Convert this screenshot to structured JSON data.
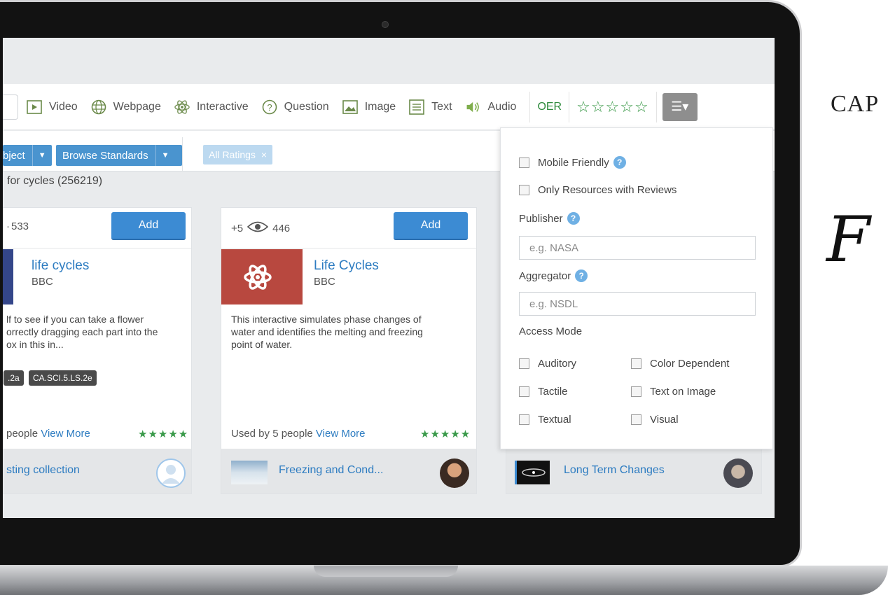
{
  "toolbar": {
    "types": [
      {
        "label": "Video",
        "icon": "video-icon"
      },
      {
        "label": "Webpage",
        "icon": "globe-icon"
      },
      {
        "label": "Interactive",
        "icon": "atom-icon"
      },
      {
        "label": "Question",
        "icon": "question-icon"
      },
      {
        "label": "Image",
        "icon": "image-icon"
      },
      {
        "label": "Text",
        "icon": "text-icon"
      },
      {
        "label": "Audio",
        "icon": "speaker-icon"
      }
    ],
    "oer": "OER",
    "stars": "☆☆☆☆☆",
    "menu_icon": "☰▾"
  },
  "browse": {
    "subject_label": "bject",
    "standards_label": "Browse Standards",
    "rating_filter": "All Ratings",
    "rating_remove": "×"
  },
  "results_text": "for cycles (256219)",
  "cards": [
    {
      "views": "533",
      "add_label": "Add",
      "title": "life cycles",
      "publisher": "BBC",
      "description_lines": [
        "lf to see if you can take a flower",
        "orrectly dragging each part into the",
        "ox in this in..."
      ],
      "tags": [
        ".2a",
        "CA.SCI.5.LS.2e"
      ],
      "used_by": "people",
      "view_more": "View More",
      "rating": "★★★★★",
      "collection": "sting collection"
    },
    {
      "plus": "+5",
      "views": "446",
      "add_label": "Add",
      "title": "Life Cycles",
      "publisher": "BBC",
      "description_lines": [
        "This interactive simulates phase changes of",
        "water and identifies the melting and freezing",
        "point of water."
      ],
      "used_by": "Used by 5 people",
      "view_more": "View More",
      "rating": "★★★★★",
      "collection": "Freezing and Cond..."
    },
    {
      "collection": "Long Term Changes"
    }
  ],
  "filter_panel": {
    "mobile_friendly": "Mobile Friendly",
    "only_reviews": "Only Resources with Reviews",
    "publisher_label": "Publisher",
    "publisher_placeholder": "e.g. NASA",
    "aggregator_label": "Aggregator",
    "aggregator_placeholder": "e.g. NSDL",
    "access_mode_label": "Access Mode",
    "access_modes": [
      "Auditory",
      "Color Dependent",
      "Tactile",
      "Text on Image",
      "Textual",
      "Visual"
    ],
    "help": "?"
  },
  "branding": {
    "cap_text": "CAP",
    "script_text": "F"
  },
  "colors": {
    "accent_blue": "#3c8bd3",
    "link_blue": "#2d7cc1",
    "star_green": "#3a9a4a"
  }
}
